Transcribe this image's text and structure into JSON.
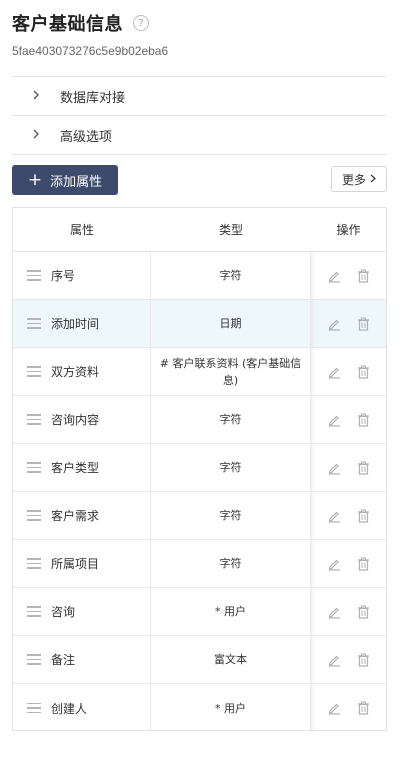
{
  "header": {
    "title": "客户基础信息",
    "help_icon": "?",
    "object_id": "5fae403073276c5e9b02eba6"
  },
  "sections": [
    {
      "label": "数据库对接",
      "icon": "chevron-right-icon"
    },
    {
      "label": "高级选项",
      "icon": "chevron-right-icon"
    }
  ],
  "toolbar": {
    "add_plus": "+",
    "add_label": "添加属性",
    "more_label": "更多"
  },
  "table": {
    "columns": [
      "属性",
      "类型",
      "操作"
    ],
    "rows": [
      {
        "name": "序号",
        "type": "字符"
      },
      {
        "name": "添加时间",
        "type": "日期"
      },
      {
        "name": "双方资料",
        "type": "# 客户联系资料 (客户基础信息)"
      },
      {
        "name": "咨询内容",
        "type": "字符"
      },
      {
        "name": "客户类型",
        "type": "字符"
      },
      {
        "name": "客户需求",
        "type": "字符"
      },
      {
        "name": "所属项目",
        "type": "字符"
      },
      {
        "name": "咨询",
        "type": "* 用户"
      },
      {
        "name": "备注",
        "type": "富文本"
      },
      {
        "name": "创建人",
        "type": "* 用户"
      }
    ],
    "highlighted_row": 1
  },
  "colors": {
    "primary_button": "#3d4a6b",
    "row_highlight": "#eef7fc",
    "icon_gray": "#b0b0b0"
  }
}
